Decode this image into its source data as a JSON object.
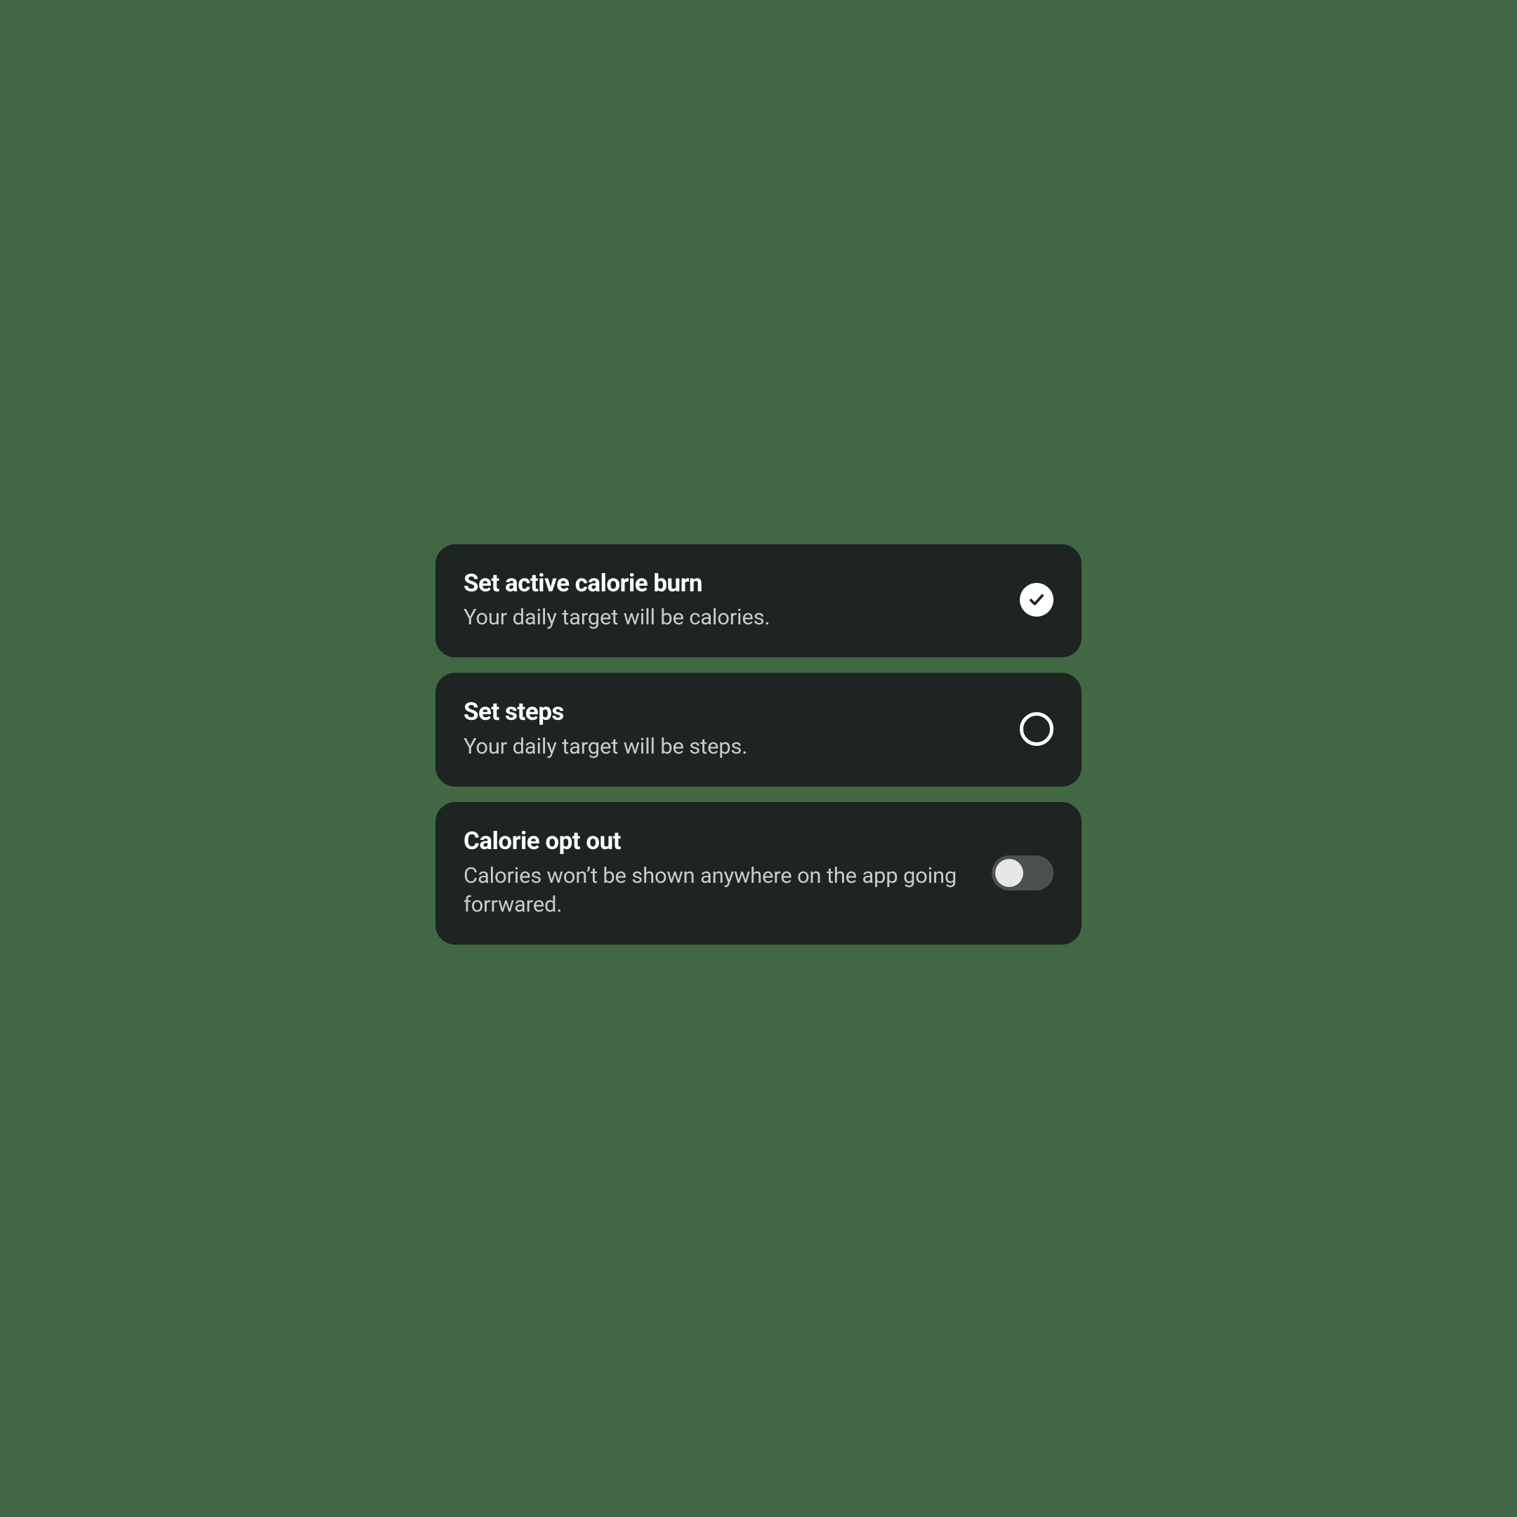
{
  "options": {
    "calorieBurn": {
      "title": "Set active calorie burn",
      "subtitle": "Your daily target will be calories.",
      "selected": true
    },
    "steps": {
      "title": "Set steps",
      "subtitle": "Your daily target will be steps.",
      "selected": false
    },
    "optOut": {
      "title": "Calorie opt out",
      "subtitle": "Calories won’t be shown anywhere on the app going forrwared.",
      "toggled": false
    }
  },
  "colors": {
    "pageBg": "#416745",
    "cardBg": "#1d2422",
    "title": "#ffffff",
    "subtitle": "#c6cdc9",
    "toggleTrack": "#4c514f",
    "toggleKnob": "#e7e7e7"
  }
}
